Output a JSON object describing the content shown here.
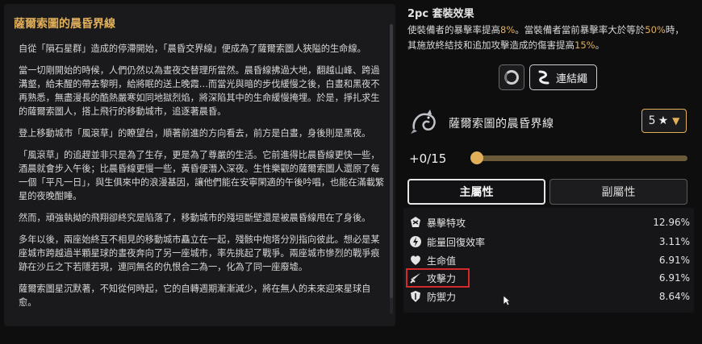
{
  "lore": {
    "title": "薩爾索圖的晨昏界線",
    "paragraphs": [
      "自從「隕石星群」造成的停滯開始，「晨昏交界線」便成為了薩爾索圖人狹隘的生命線。",
      "當一切剛開始的時候，人們仍然以為晝夜交替理所當然。晨昏線拂過大地，翻越山峰、跨過溝壑，給未醒的帶去黎明，給將眠的送上晚霞…而當光與暗的步伐緩慢之後，白晝和黑夜不再熟悉，無盡漫長的酷熱嚴寒如同地獄烈焰，將深陷其中的生命緩慢掩埋。於是，掙扎求生的薩爾索圖人，搭上飛行的移動城市，追逐著晨昏。",
      "登上移動城市「風滾草」的瞭望台，順著前進的方向看去，前方是白晝，身後則是黑夜。",
      "「風滾草」的追趕並非只是為了生存，更是為了尊嚴的生活。它前進得比晨昏線更快一些，酒晨就會步入午後；比晨昏線更慢一些，黃昏便潛入深夜。生性樂觀的薩爾索圖人還原了每一個「平凡一日」，與生俱來中的浪漫基因，讓他們能在安寧閑適的午後吟唱，也能在滿載繁星的夜晚酣睡。",
      "然而，頑強執拗的飛翔卻終究是陷落了，移動城市的殘垣斷壁還是被晨昏線甩在了身後。",
      "多年以後，兩座始終互不相見的移動城市矗立在一起，殘骸中炮塔分別指向彼此。想必是某座城市跨越過半顆星球的晝夜奔向了另一座城市，率先挑起了戰爭。兩座城市慘烈的戰爭痕跡在沙丘之下若隱若現，連同無名的仇恨合二為一，化為了同一座廢墟。",
      "薩爾索圖星沉默著，不知從何時起，它的自轉週期漸漸減少，將在無人的未來迎來星球自愈。"
    ]
  },
  "set_effect": {
    "title": "2pc 套裝效果",
    "desc_parts": [
      "使裝備者的暴擊率提高",
      "8%",
      "。當裝備者當前暴擊率大於等於",
      "50%",
      "時，其施放終結技和追加攻擊造成的傷害提高",
      "15%",
      "。"
    ]
  },
  "link_button_label": "連結繩",
  "cone": {
    "name": "薩爾索圖的晨昏界線",
    "rank": "5",
    "star_glyph": "★",
    "chevron_glyph": "▼"
  },
  "level": {
    "label": "+0/15",
    "progress": 0
  },
  "tabs": {
    "main": "主屬性",
    "sub": "副屬性"
  },
  "stats": [
    {
      "label": "暴擊特攻",
      "value": "12.96%",
      "icon": "crit-dmg-icon"
    },
    {
      "label": "能量回復效率",
      "value": "3.11%",
      "icon": "energy-regen-icon"
    },
    {
      "label": "生命值",
      "value": "6.91%",
      "icon": "hp-icon"
    },
    {
      "label": "攻擊力",
      "value": "6.91%",
      "icon": "atk-icon"
    },
    {
      "label": "防禦力",
      "value": "8.64%",
      "icon": "def-icon"
    }
  ],
  "colors": {
    "accent": "#e2b05a",
    "highlight_box": "#d22a2a"
  }
}
